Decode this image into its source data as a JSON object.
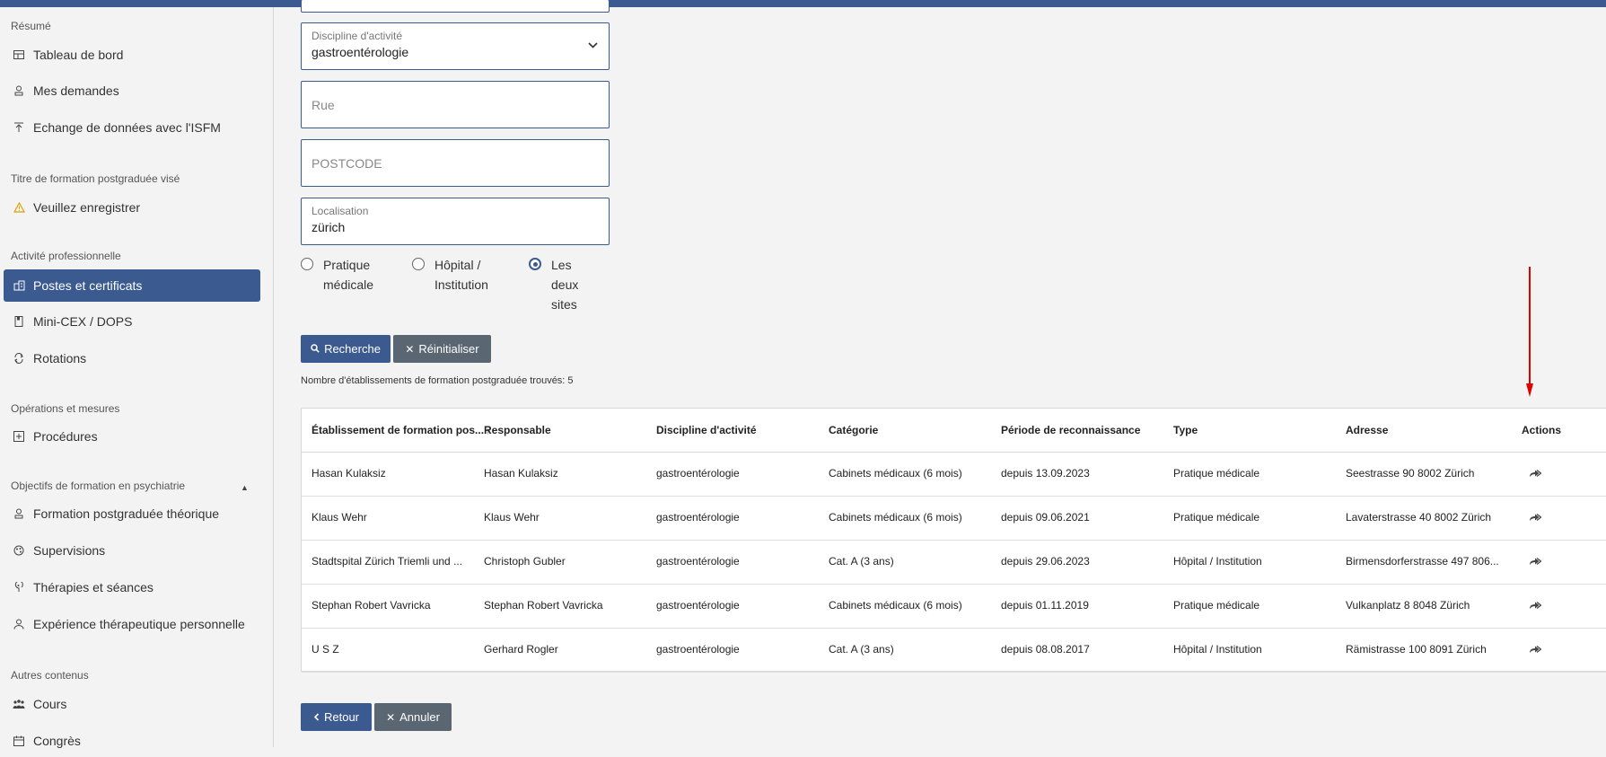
{
  "sidebar": {
    "sections": [
      {
        "title": "Résumé",
        "items": [
          "Tableau de bord",
          "Mes demandes",
          "Echange de données avec l'ISFM"
        ]
      },
      {
        "title": "Titre de formation postgraduée visé",
        "items": [
          "Veuillez enregistrer"
        ]
      },
      {
        "title": "Activité professionnelle",
        "items": [
          "Postes et certificats",
          "Mini-CEX / DOPS",
          "Rotations"
        ]
      },
      {
        "title": "Opérations et mesures",
        "items": [
          "Procédures"
        ]
      },
      {
        "title": "Objectifs de formation en psychiatrie",
        "items": [
          "Formation postgraduée théorique",
          "Supervisions",
          "Thérapies et séances",
          "Expérience thérapeutique personnelle"
        ]
      },
      {
        "title": "Autres contenus",
        "items": [
          "Cours",
          "Congrès"
        ]
      }
    ],
    "active_item": "Postes et certificats"
  },
  "form": {
    "discipline": {
      "label": "Discipline d'activité",
      "value": "gastroentérologie"
    },
    "street": {
      "placeholder": "Rue"
    },
    "postcode": {
      "placeholder": "POSTCODE"
    },
    "location": {
      "label": "Localisation",
      "value": "zürich"
    },
    "radios": [
      {
        "lines": [
          "Pratique",
          "médicale"
        ],
        "checked": false
      },
      {
        "lines": [
          "Hôpital /",
          "Institution"
        ],
        "checked": false
      },
      {
        "lines": [
          "Les",
          "deux",
          "sites"
        ],
        "checked": true
      }
    ],
    "search_label": "Recherche",
    "reset_label": "Réinitialiser"
  },
  "results": {
    "count_text": "Nombre d'établissements de formation postgraduée trouvés: 5",
    "columns": [
      "Établissement de formation pos...",
      "Responsable",
      "Discipline d'activité",
      "Catégorie",
      "Période de reconnaissance",
      "Type",
      "Adresse",
      "Actions"
    ],
    "sort_indicator": "↑",
    "rows": [
      [
        "Hasan Kulaksiz",
        "Hasan Kulaksiz",
        "gastroentérologie",
        "Cabinets médicaux (6 mois)",
        "depuis 13.09.2023",
        "Pratique médicale",
        "Seestrasse 90 8002 Zürich"
      ],
      [
        "Klaus Wehr",
        "Klaus Wehr",
        "gastroentérologie",
        "Cabinets médicaux (6 mois)",
        "depuis 09.06.2021",
        "Pratique médicale",
        "Lavaterstrasse 40 8002 Zürich"
      ],
      [
        "Stadtspital Zürich Triemli und ...",
        "Christoph Gubler",
        "gastroentérologie",
        "Cat. A (3 ans)",
        "depuis 29.06.2023",
        "Hôpital / Institution",
        "Birmensdorferstrasse 497 806..."
      ],
      [
        "Stephan Robert Vavricka",
        "Stephan Robert Vavricka",
        "gastroentérologie",
        "Cabinets médicaux (6 mois)",
        "depuis 01.11.2019",
        "Pratique médicale",
        "Vulkanplatz 8 8048 Zürich"
      ],
      [
        "U S Z",
        "Gerhard Rogler",
        "gastroentérologie",
        "Cat. A (3 ans)",
        "depuis 08.08.2017",
        "Hôpital / Institution",
        "Rämistrasse 100 8091 Zürich"
      ]
    ]
  },
  "footer": {
    "back_label": "Retour",
    "cancel_label": "Annuler"
  },
  "colors": {
    "accent": "#3b5a8f",
    "secondary": "#5a6672",
    "annotation_arrow": "#e00000"
  }
}
